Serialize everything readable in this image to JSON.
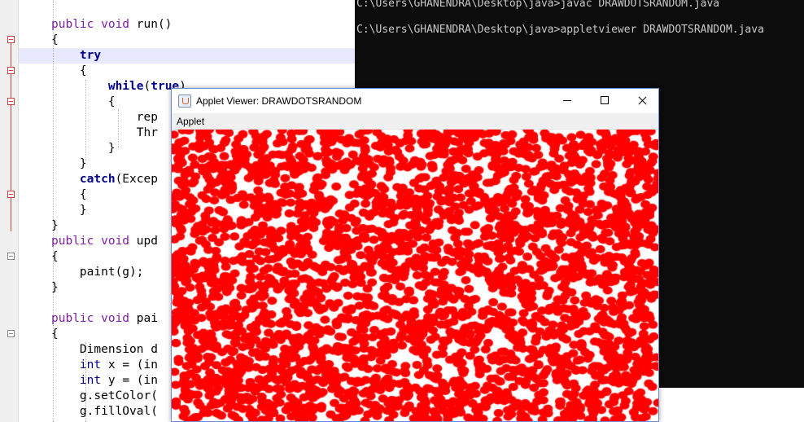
{
  "editor": {
    "lines": [
      {
        "parts": [
          {
            "t": "public void ",
            "c": "kw"
          },
          {
            "t": "run()",
            "c": "pl"
          }
        ]
      },
      {
        "parts": [
          {
            "t": "{",
            "c": "pl"
          }
        ]
      },
      {
        "parts": [
          {
            "t": "    ",
            "c": "pl"
          },
          {
            "t": "try",
            "c": "kwb"
          }
        ]
      },
      {
        "parts": [
          {
            "t": "    {",
            "c": "pl"
          }
        ]
      },
      {
        "parts": [
          {
            "t": "        ",
            "c": "pl"
          },
          {
            "t": "while",
            "c": "kwb"
          },
          {
            "t": "(",
            "c": "pl"
          },
          {
            "t": "true",
            "c": "kwb"
          },
          {
            "t": ")",
            "c": "pl"
          }
        ]
      },
      {
        "parts": [
          {
            "t": "        {",
            "c": "pl"
          }
        ]
      },
      {
        "parts": [
          {
            "t": "            rep",
            "c": "pl"
          }
        ]
      },
      {
        "parts": [
          {
            "t": "            Thr",
            "c": "pl"
          }
        ]
      },
      {
        "parts": [
          {
            "t": "        }",
            "c": "pl"
          }
        ]
      },
      {
        "parts": [
          {
            "t": "    }",
            "c": "pl"
          }
        ]
      },
      {
        "parts": [
          {
            "t": "    ",
            "c": "pl"
          },
          {
            "t": "catch",
            "c": "kwb"
          },
          {
            "t": "(Excep",
            "c": "pl"
          }
        ]
      },
      {
        "parts": [
          {
            "t": "    {",
            "c": "pl"
          }
        ]
      },
      {
        "parts": [
          {
            "t": "    }",
            "c": "pl"
          }
        ]
      },
      {
        "parts": [
          {
            "t": "}",
            "c": "pl"
          }
        ]
      },
      {
        "parts": [
          {
            "t": "public void ",
            "c": "kw"
          },
          {
            "t": "upd",
            "c": "pl"
          }
        ]
      },
      {
        "parts": [
          {
            "t": "{",
            "c": "pl"
          }
        ]
      },
      {
        "parts": [
          {
            "t": "    paint(g);",
            "c": "pl"
          }
        ]
      },
      {
        "parts": [
          {
            "t": "}",
            "c": "pl"
          }
        ]
      },
      {
        "parts": [
          {
            "t": "",
            "c": "pl"
          }
        ]
      },
      {
        "parts": [
          {
            "t": "public void ",
            "c": "kw"
          },
          {
            "t": "pai",
            "c": "pl"
          }
        ]
      },
      {
        "parts": [
          {
            "t": "{",
            "c": "pl"
          }
        ]
      },
      {
        "parts": [
          {
            "t": "    Dimension d",
            "c": "pl"
          }
        ]
      },
      {
        "parts": [
          {
            "t": "    ",
            "c": "pl"
          },
          {
            "t": "int",
            "c": "ty"
          },
          {
            "t": " x = (in",
            "c": "pl"
          }
        ]
      },
      {
        "parts": [
          {
            "t": "    ",
            "c": "pl"
          },
          {
            "t": "int",
            "c": "ty"
          },
          {
            "t": " y = (in",
            "c": "pl"
          }
        ]
      },
      {
        "parts": [
          {
            "t": "    g.setColor(",
            "c": "pl"
          }
        ]
      },
      {
        "parts": [
          {
            "t": "    g.fillOval(",
            "c": "pl"
          }
        ]
      }
    ]
  },
  "console": {
    "lines": [
      "C:\\Users\\GHANENDRA\\Desktop\\java>javac DRAWDOTSRANDOM.java",
      "",
      "C:\\Users\\GHANENDRA\\Desktop\\java>appletviewer DRAWDOTSRANDOM.java"
    ]
  },
  "applet_window": {
    "title": "Applet Viewer: DRAWDOTSRANDOM",
    "menu": "Applet",
    "icon": "java-cup-icon",
    "controls": [
      "minimize-icon",
      "maximize-icon",
      "close-icon"
    ],
    "canvas": {
      "background": "#ffffff",
      "dot_color": "#ff0000"
    }
  },
  "colors": {
    "keyword": "#7b1fa2",
    "keyword_bold": "#00008b",
    "console_bg": "#0c0c0c",
    "console_text": "#c8c8c8",
    "line_highlight": "#e8e8ff",
    "fold_marker": "#d04040"
  }
}
